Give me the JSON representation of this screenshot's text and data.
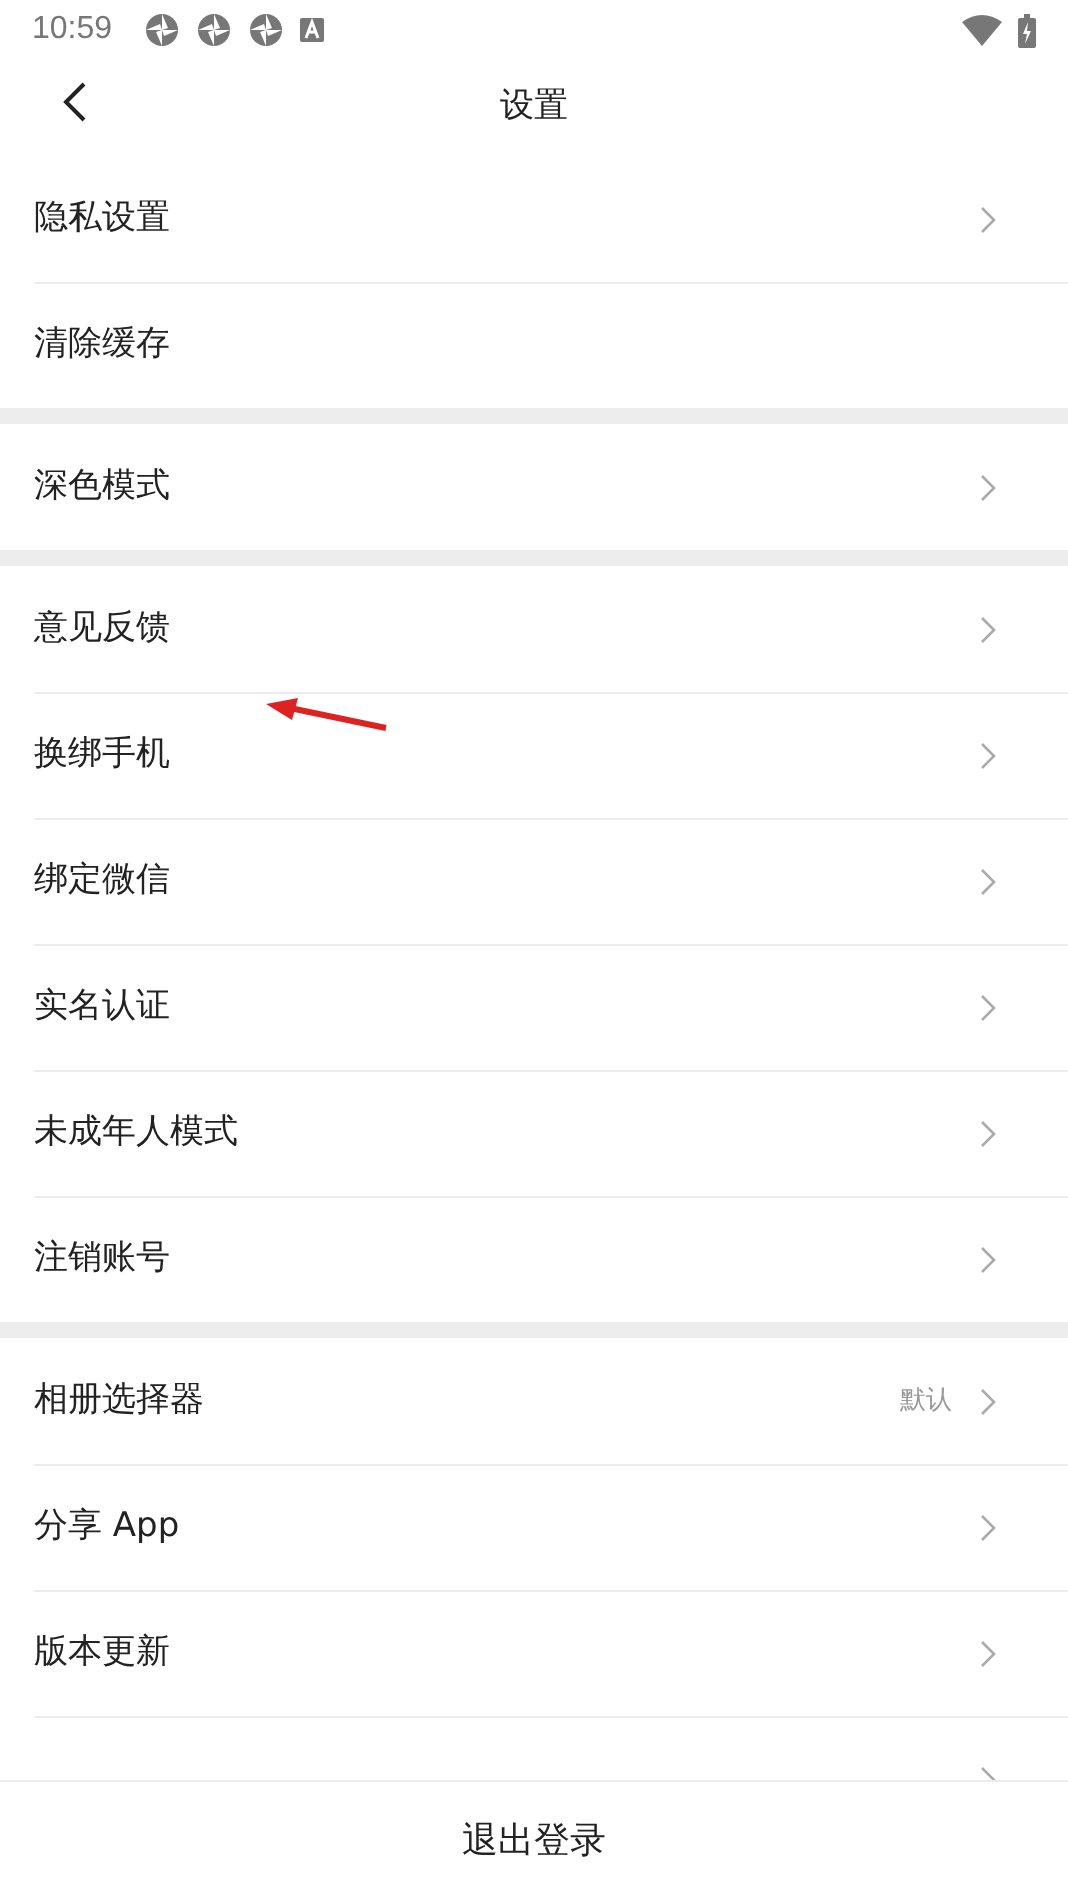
{
  "status_bar": {
    "time": "10:59"
  },
  "header": {
    "title": "设置"
  },
  "groups": [
    {
      "items": [
        {
          "label": "隐私设置",
          "chevron": true
        },
        {
          "label": "清除缓存",
          "chevron": false
        }
      ]
    },
    {
      "items": [
        {
          "label": "深色模式",
          "chevron": true
        }
      ]
    },
    {
      "items": [
        {
          "label": "意见反馈",
          "chevron": true
        },
        {
          "label": "换绑手机",
          "chevron": true,
          "annotated": true
        },
        {
          "label": "绑定微信",
          "chevron": true
        },
        {
          "label": "实名认证",
          "chevron": true
        },
        {
          "label": "未成年人模式",
          "chevron": true
        },
        {
          "label": "注销账号",
          "chevron": true
        }
      ]
    },
    {
      "items": [
        {
          "label": "相册选择器",
          "chevron": true,
          "value": "默认"
        },
        {
          "label": "分享 App",
          "chevron": true
        },
        {
          "label": "版本更新",
          "chevron": true
        },
        {
          "chevron": true
        }
      ]
    }
  ],
  "logout": {
    "label": "退出登录"
  }
}
